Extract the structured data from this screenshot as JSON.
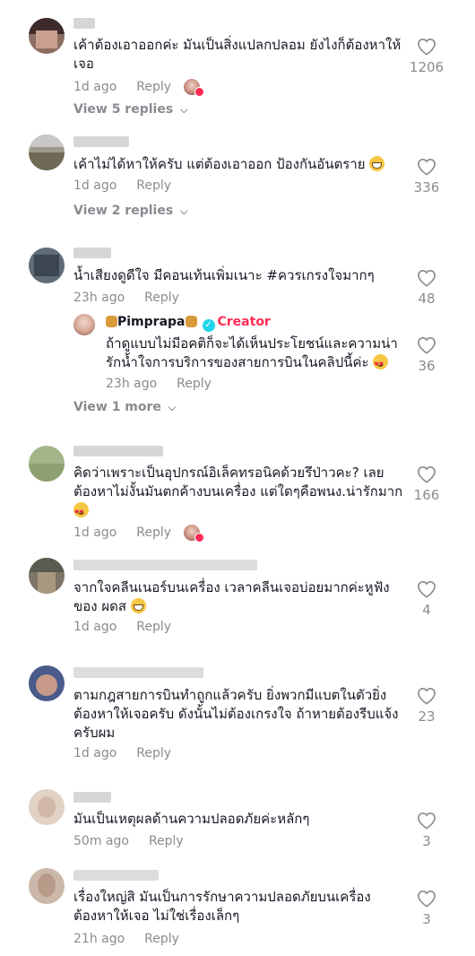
{
  "comments": [
    {
      "text": "เค้าต้องเอาออกค่ะ มันเป็นสิ่งแปลกปลอม ยังไงก็ต้องหาให้เจอ",
      "time": "1d ago",
      "reply_label": "Reply",
      "likes": "1206",
      "view_replies": "View 5 replies",
      "creator_liked": true
    },
    {
      "text": "เค้าไม่ได้หาให้ครับ แต่ต้องเอาออก ป้องกันอันตราย",
      "emoji": "grinning-sweat-emoji",
      "time": "1d ago",
      "reply_label": "Reply",
      "likes": "336",
      "view_replies": "View 2 replies"
    },
    {
      "text": "น้ำเสียงดูดีใจ มีคอนเท้นเพิ่มเนาะ #ควรเกรงใจมากๆ",
      "time": "23h ago",
      "reply_label": "Reply",
      "likes": "48",
      "view_replies": "View 1 more",
      "creator_reply": {
        "name": "Pimprapa",
        "badge": "Creator",
        "text": "ถ้าดูแบบไม่มีอคติก็จะได้เห็นประโยชน์และความน่ารักน้ำใจการบริการของสายการบินในคลิปนี้ค่ะ",
        "emoji": "smiling-hearts-emoji",
        "time": "23h ago",
        "reply_label": "Reply",
        "likes": "36"
      }
    },
    {
      "text": "คิดว่าเพราะเป็นอุปกรณ์อิเล็คทรอนิคด้วยรึป่าวคะ? เลยต้องหาไม่งั้นมันตกค้างบนเครื่อง แต่ใดๆคือพนง.น่ารักมาก",
      "emoji": "smiling-hearts-emoji",
      "time": "1d ago",
      "reply_label": "Reply",
      "likes": "166",
      "creator_liked": true
    },
    {
      "text": "จากใจคลีนเนอร์บนเครื่อง เวลาคลีนเจอบ่อยมากค่ะหูฟังของ ผดส",
      "emoji": "grinning-sweat-emoji",
      "time": "1d ago",
      "reply_label": "Reply",
      "likes": "4"
    },
    {
      "text": "ตามกฎสายการบินทำถูกแล้วครับ ยิ่งพวกมีแบตในตัวยิ่งต้องหาให้เจอครับ ดังนั้นไม่ต้องเกรงใจ ถ้าหายต้องรีบแจ้งครับผม",
      "time": "1d ago",
      "reply_label": "Reply",
      "likes": "23"
    },
    {
      "text": "มันเป็นเหตุผลด้านความปลอดภัยค่ะหลักๆ",
      "time": "50m ago",
      "reply_label": "Reply",
      "likes": "3"
    },
    {
      "text": "เรื่องใหญ่สิ มันเป็นการรักษาความปลอดภัยบนเครื่อง ต้องหาให้เจอ ไม่ใช่เรื่องเล็กๆ",
      "time": "21h ago",
      "reply_label": "Reply",
      "likes": "3"
    }
  ],
  "colors": {
    "meta": "#8a8b91",
    "text": "#161823",
    "creator": "#fe2c55",
    "verified": "#20d5ec"
  },
  "icons": {
    "like": "heart-outline-icon",
    "expand": "chevron-down-icon"
  }
}
